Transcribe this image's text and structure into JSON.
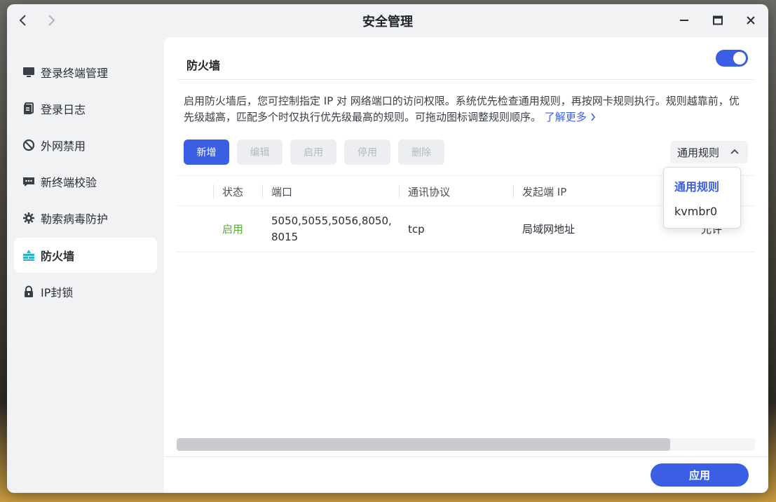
{
  "window": {
    "title": "安全管理"
  },
  "sidebar": {
    "items": [
      {
        "label": "登录终端管理",
        "icon": "monitor-icon"
      },
      {
        "label": "登录日志",
        "icon": "log-icon"
      },
      {
        "label": "外网禁用",
        "icon": "ban-icon"
      },
      {
        "label": "新终端校验",
        "icon": "chat-icon"
      },
      {
        "label": "勒索病毒防护",
        "icon": "gear-icon"
      },
      {
        "label": "防火墙",
        "icon": "firewall-icon",
        "active": true
      },
      {
        "label": "IP封锁",
        "icon": "lock-icon"
      }
    ]
  },
  "main": {
    "section_title": "防火墙",
    "toggle_on": true,
    "description": "启用防火墙后，您可控制指定 IP 对 网络端口的访问权限。系统优先检查通用规则，再按网卡规则执行。规则越靠前，优先级越高，匹配多个时仅执行优先级最高的规则。可拖动图标调整规则顺序。",
    "learn_more": "了解更多",
    "toolbar": {
      "add": "新增",
      "edit": "编辑",
      "enable": "启用",
      "disable": "停用",
      "delete": "删除"
    },
    "rule_select": {
      "value": "通用规则",
      "options": [
        "通用规则",
        "kvmbr0"
      ]
    },
    "table": {
      "columns": [
        "状态",
        "端口",
        "通讯协议",
        "发起端 IP"
      ],
      "rows": [
        {
          "status": "启用",
          "port_line1": "5050,5055,5056,8050,",
          "port_line2": "8015",
          "protocol": "tcp",
          "source_ip": "局域网地址",
          "action": "允许"
        }
      ]
    },
    "scroll_position_fraction": 0.85,
    "apply": "应用"
  },
  "colors": {
    "accent": "#3a5fe5",
    "status_enabled": "#52b12e"
  }
}
